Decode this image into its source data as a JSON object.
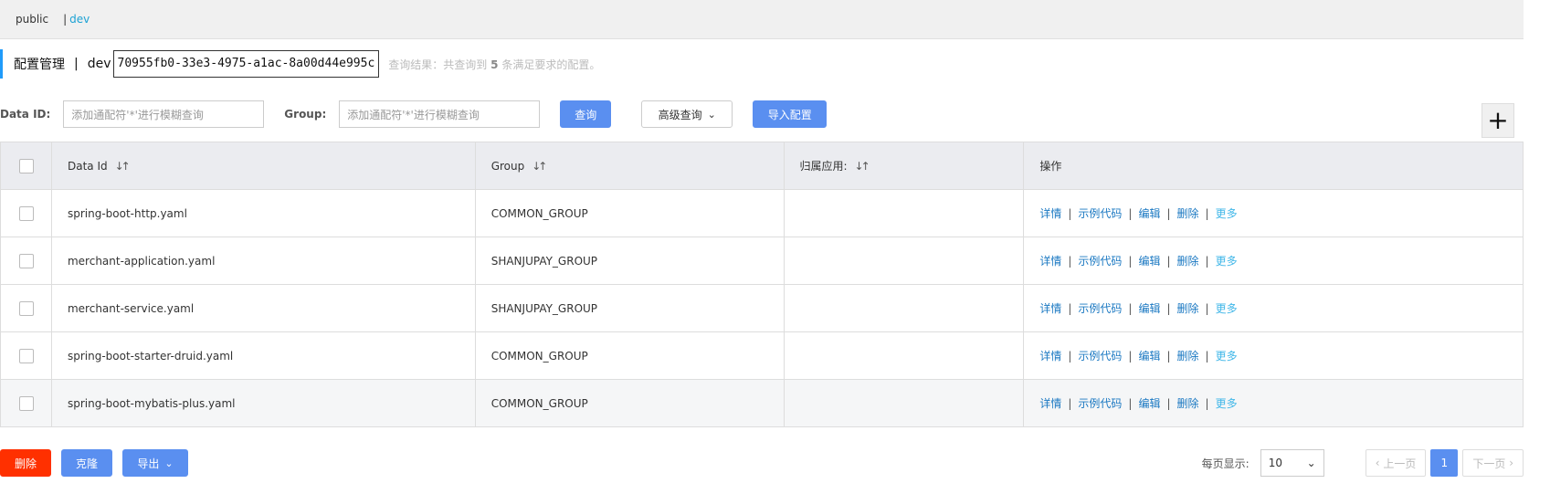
{
  "namespaces": {
    "items": [
      {
        "label": "public"
      },
      {
        "sep": "|",
        "label": "dev"
      }
    ]
  },
  "header": {
    "title": "配置管理",
    "sep": "|",
    "namespace": "dev",
    "namespace_id": "70955fb0-33e3-4975-a1ac-8a00d44e995c",
    "result_prefix": "查询结果：共查询到",
    "result_count": "5",
    "result_suffix": "条满足要求的配置。"
  },
  "filters": {
    "data_id_label": "Data ID:",
    "data_id_placeholder": "添加通配符'*'进行模糊查询",
    "group_label": "Group:",
    "group_placeholder": "添加通配符'*'进行模糊查询",
    "search_label": "查询",
    "advanced_label": "高级查询",
    "import_label": "导入配置"
  },
  "add_button": {
    "icon": "plus-icon",
    "glyph": "+"
  },
  "table": {
    "columns": [
      "Data Id",
      "Group",
      "归属应用:",
      "操作"
    ],
    "sort_glyph": "↓↑",
    "rows": [
      {
        "data_id": "spring-boot-http.yaml",
        "group": "COMMON_GROUP",
        "app": ""
      },
      {
        "data_id": "merchant-application.yaml",
        "group": "SHANJUPAY_GROUP",
        "app": ""
      },
      {
        "data_id": "merchant-service.yaml",
        "group": "SHANJUPAY_GROUP",
        "app": ""
      },
      {
        "data_id": "spring-boot-starter-druid.yaml",
        "group": "COMMON_GROUP",
        "app": ""
      },
      {
        "data_id": "spring-boot-mybatis-plus.yaml",
        "group": "COMMON_GROUP",
        "app": ""
      }
    ],
    "actions": {
      "detail": "详情",
      "sample_code": "示例代码",
      "edit": "编辑",
      "delete": "删除",
      "more": "更多",
      "sep": "|"
    }
  },
  "bottom": {
    "delete_label": "删除",
    "clone_label": "克隆",
    "export_label": "导出"
  },
  "pagination": {
    "page_size_label": "每页显示:",
    "page_size": "10",
    "prev_label": "上一页",
    "next_label": "下一页",
    "current_page": "1"
  },
  "colors": {
    "accent": "#5a8ff0",
    "danger": "#ff3000",
    "link": "#1a78c2",
    "active_ns": "#1ca2d4"
  }
}
